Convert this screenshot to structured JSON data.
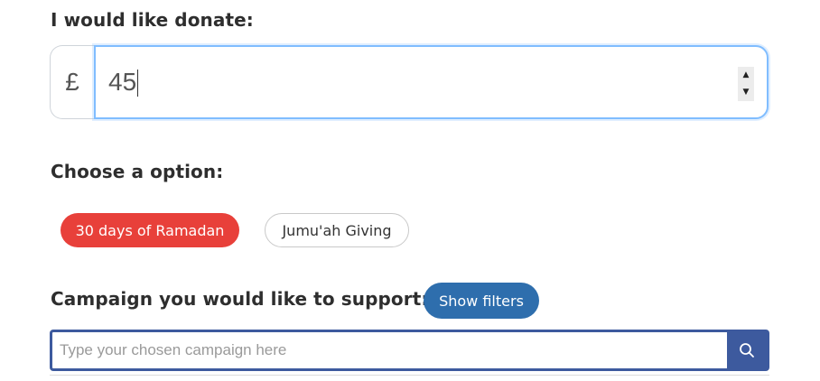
{
  "donation": {
    "heading": "I would like donate:",
    "currency_symbol": "£",
    "amount": "45"
  },
  "options": {
    "heading": "Choose a option:",
    "items": [
      {
        "label": "30 days of Ramadan",
        "selected": true
      },
      {
        "label": "Jumu'ah Giving",
        "selected": false
      }
    ]
  },
  "campaign": {
    "heading": "Campaign you would like to support:",
    "show_filters_label": "Show filters",
    "search_placeholder": "Type your chosen campaign here",
    "search_icon": "search-icon"
  },
  "colors": {
    "selected_option": "#e8403a",
    "filters_button": "#2e6ead",
    "search_accent": "#3d5a9e",
    "focus_border": "#80bdff"
  }
}
